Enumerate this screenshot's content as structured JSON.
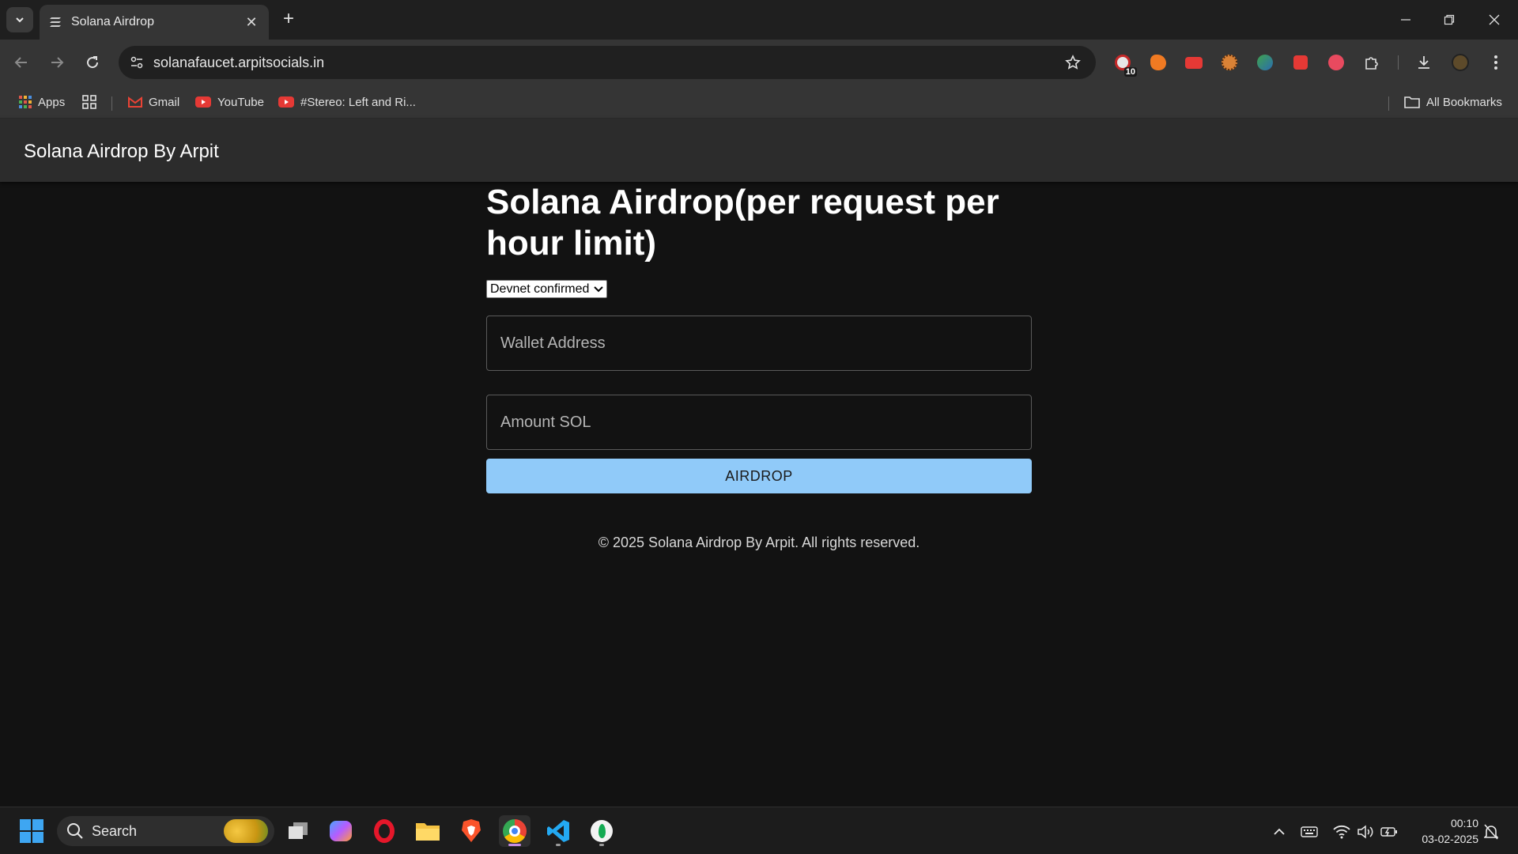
{
  "browser": {
    "tab_title": "Solana Airdrop",
    "url": "solanafaucet.arpitsocials.in",
    "extension_badge": "10",
    "bookmarks": [
      {
        "label": "Apps"
      },
      {
        "label": "Gmail"
      },
      {
        "label": "YouTube"
      },
      {
        "label": "#Stereo: Left and Ri..."
      }
    ],
    "all_bookmarks": "All Bookmarks"
  },
  "site": {
    "brand": "Solana Airdrop By Arpit",
    "heading": "Solana Airdrop(per request per hour limit)",
    "network_selected": "Devnet confirmed",
    "wallet_placeholder": "Wallet Address",
    "amount_placeholder": "Amount SOL",
    "airdrop_button": "AIRDROP",
    "footer": "© 2025 Solana Airdrop By Arpit. All rights reserved."
  },
  "taskbar": {
    "search_label": "Search",
    "time": "00:10",
    "date": "03-02-2025"
  },
  "colors": {
    "accent_button": "#90caf9",
    "page_background": "#121212",
    "header_background": "#2c2c2c"
  }
}
